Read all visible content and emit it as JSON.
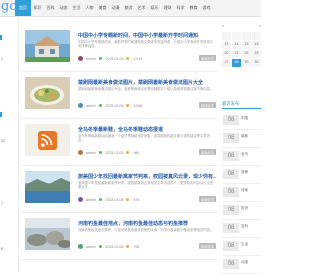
{
  "nav": {
    "logo": "go",
    "items": [
      "首页",
      "知识",
      "百科",
      "动态",
      "生活",
      "人物",
      "美食",
      "动漫",
      "旅游",
      "艺术",
      "娱乐",
      "理财",
      "科学",
      "教育",
      "游戏"
    ]
  },
  "left": {
    "labels": [
      "1",
      "12",
      "7",
      "8"
    ]
  },
  "articles": [
    {
      "title": "中国中小学专题新时间，中国中小学最新开学时间通知",
      "desc": "中国中小学专题新时间，最新开学时间通知的文章详情内容列表，介绍中小学各地开学信息与安排等内容。",
      "author": "admin",
      "date": "2023-02-08",
      "views": "1,234",
      "read": "阅读全文",
      "thumb": "house"
    },
    {
      "title": "菜刷网最新美食做法图片，菜刷网最新美食做法图片大全",
      "desc": "菜刷网最新美食做法图片大全，各种美食做法步骤详细图文介绍以及家常菜做法技巧等内容。",
      "author": "admin",
      "date": "2023-02-08",
      "views": "1,056",
      "read": "阅读全文",
      "thumb": "food"
    },
    {
      "title": "全马冬季最新鞋，全马冬季鞋动态报道",
      "desc": "全马冬季最新鞋动态报道，介绍冬季跑鞋相关信息，各类跑鞋性能评测与选购建议等文章内容。",
      "author": "admin",
      "date": "2023-02-08",
      "views": "986",
      "read": "阅读全文",
      "thumb": "rss"
    },
    {
      "title": "旅美国少年找回最新离家节判来，校园被真风云录，现少你有...",
      "desc": "旅美国少年找回最新离家节判来，校园被真风云录相关文章内容简介，更多精彩内容请点击查看全文。",
      "author": "admin",
      "date": "2023-02-08",
      "views": "876",
      "read": "阅读全文",
      "thumb": "sea"
    },
    {
      "title": "河南钓鱼最佳地点，河南钓鱼最佳动态与钓鱼推荐",
      "desc": "河南钓鱼最佳地点推荐，介绍河南各地适合钓鱼的水库、河流以及最新钓鱼动态等相关内容。",
      "author": "admin",
      "date": "2023-02-08",
      "views": "765",
      "read": "阅读全文",
      "thumb": "rocks"
    }
  ],
  "calendar": {
    "prev": "«",
    "next": "»",
    "rows": [
      [
        "",
        "",
        "",
        ""
      ],
      [
        "13",
        "14",
        "15",
        "16"
      ],
      [
        "20",
        "21",
        "22",
        "23"
      ],
      [
        "27",
        "28",
        "29",
        "30"
      ]
    ],
    "today": "28"
  },
  "sidebar": {
    "title": "最近发布",
    "items": [
      {
        "day": "08",
        "label": "中国"
      },
      {
        "day": "08",
        "label": "菜刷"
      },
      {
        "day": "08",
        "label": "全马"
      },
      {
        "day": "08",
        "label": "旅美"
      },
      {
        "day": "08",
        "label": "河南"
      },
      {
        "day": "08",
        "label": "知识"
      },
      {
        "day": "08",
        "label": "百科"
      },
      {
        "day": "08",
        "label": "生活"
      },
      {
        "day": "08",
        "label": "动漫"
      }
    ]
  },
  "colors": {
    "accent": "#2f9fd9",
    "title": "#2a5ea8"
  }
}
